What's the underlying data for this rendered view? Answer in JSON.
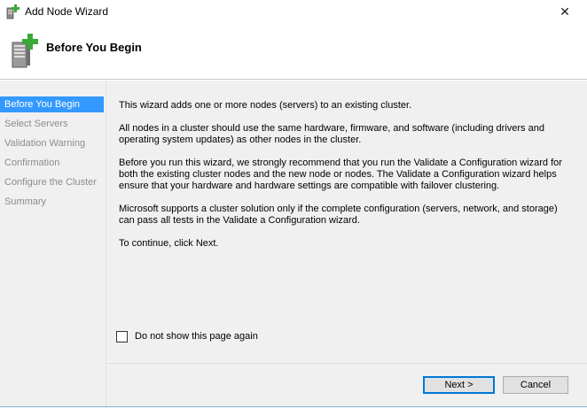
{
  "window": {
    "title": "Add Node Wizard",
    "close_glyph": "✕"
  },
  "header": {
    "title": "Before You Begin",
    "icon": "server-add-icon"
  },
  "nav": {
    "items": [
      {
        "label": "Before You Begin",
        "active": true
      },
      {
        "label": "Select Servers",
        "active": false
      },
      {
        "label": "Validation Warning",
        "active": false
      },
      {
        "label": "Confirmation",
        "active": false
      },
      {
        "label": "Configure the Cluster",
        "active": false
      },
      {
        "label": "Summary",
        "active": false
      }
    ]
  },
  "main": {
    "paragraphs": [
      "This wizard adds one or more nodes (servers) to an existing cluster.",
      "All nodes in a cluster should use the same hardware, firmware, and software (including drivers and operating system updates) as other nodes in the cluster.",
      "Before you run this wizard, we strongly recommend that you run the Validate a Configuration wizard for both the existing cluster nodes and the new node or nodes. The Validate a Configuration wizard helps ensure that your hardware and hardware settings are compatible with failover clustering.",
      "Microsoft supports a cluster solution only if the complete configuration (servers, network, and storage) can pass all tests in the Validate a Configuration wizard.",
      "To continue, click Next."
    ]
  },
  "options": {
    "dont_show_label": "Do not show this page again",
    "dont_show_checked": false
  },
  "buttons": {
    "next_label": "Next >",
    "cancel_label": "Cancel"
  },
  "colors": {
    "nav_active_bg": "#3399ff",
    "content_bg": "#f0f0f0",
    "primary_border": "#0078d7"
  }
}
